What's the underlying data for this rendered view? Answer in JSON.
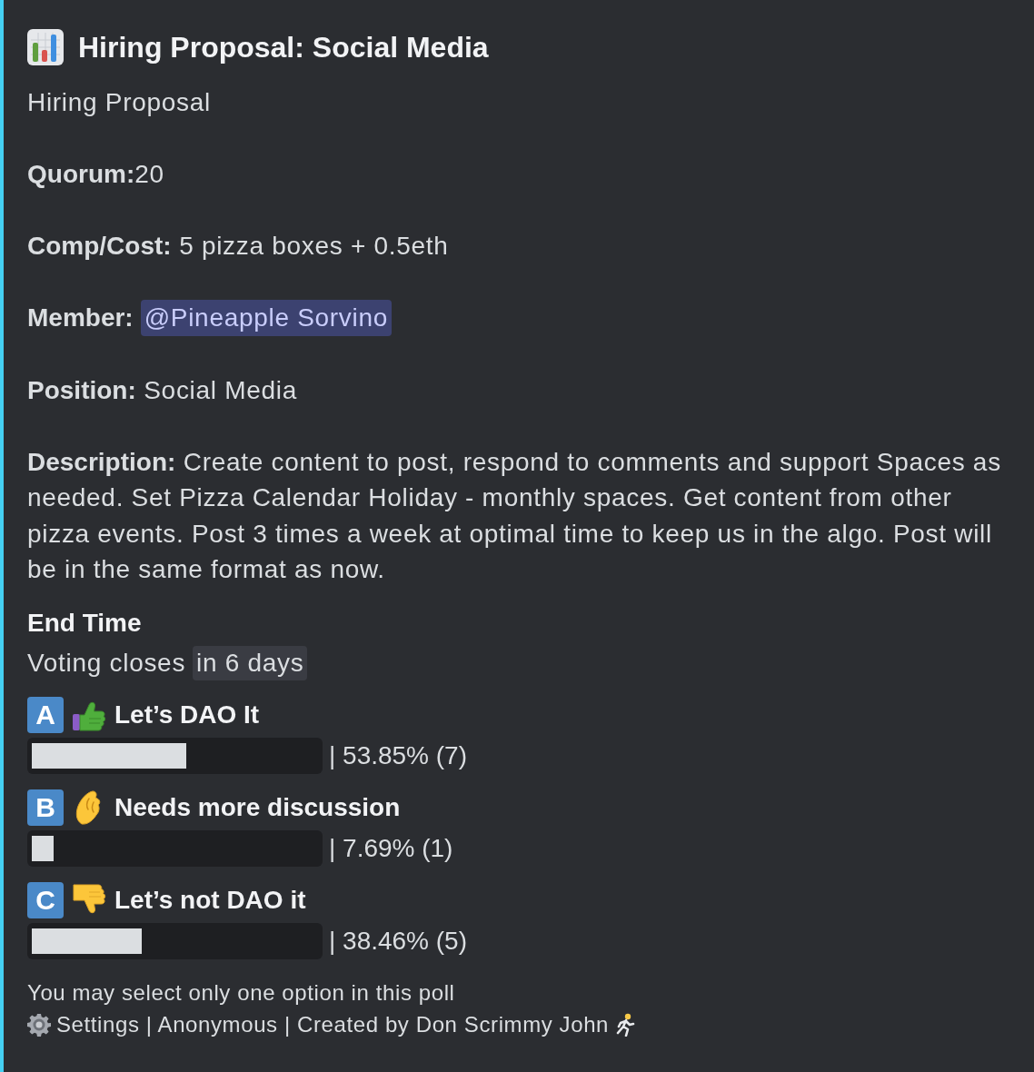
{
  "title": "Hiring Proposal: Social Media",
  "lines": [
    {
      "kind": "text",
      "text": "Hiring Proposal"
    },
    {
      "kind": "text",
      "text": "**Quorum:**20"
    },
    {
      "kind": "text",
      "text": "**Comp/Cost:** 5 pizza boxes + 0.5eth"
    },
    {
      "kind": "mention",
      "label": "Member:",
      "mention": "@Pineapple Sorvino"
    },
    {
      "kind": "text",
      "text": "**Position:** Social Media"
    },
    {
      "kind": "text",
      "text": "**Description:** Create content to post, respond to comments and support Spaces as needed. Set Pizza Calendar Holiday - monthly spaces. Get content from other pizza events. Post 3 times a week at optimal time to keep us in the algo. Post will be in the same format as now."
    }
  ],
  "end_time": {
    "name": "End Time",
    "prefix": "Voting closes",
    "timestamp": "in 6 days"
  },
  "options": [
    {
      "letter": "A",
      "kind": "thumbsup",
      "label": "Let’s DAO It",
      "level": 0.5385,
      "result": "| 53.85% (7)"
    },
    {
      "letter": "B",
      "kind": "pinch",
      "label": "Needs more discussion",
      "level": 0.0769,
      "result": "| 7.69% (1)"
    },
    {
      "letter": "C",
      "kind": "thumbsdown",
      "label": "Let’s not DAO it",
      "level": 0.3846,
      "result": "| 38.46% (5)"
    }
  ],
  "footer": {
    "note": "You may select only one option in this poll",
    "meta": "Settings | Anonymous | Created by Don Scrimmy John"
  }
}
